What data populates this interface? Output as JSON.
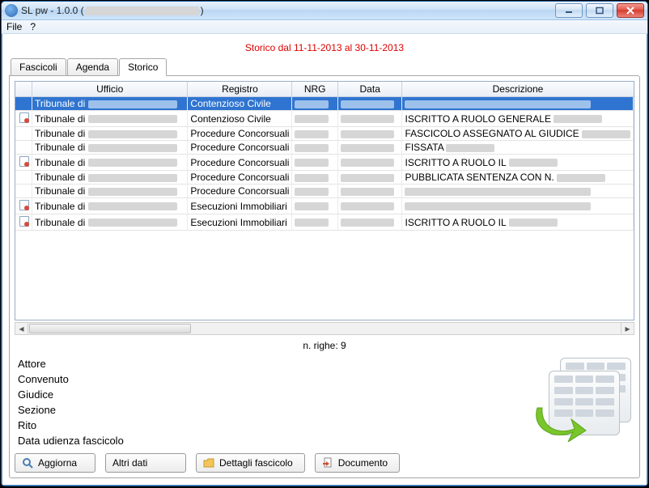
{
  "window": {
    "title_prefix": "SL pw - 1.0.0 (",
    "title_suffix": ")"
  },
  "menu": {
    "file": "File",
    "help": "?"
  },
  "banner": "Storico dal 11-11-2013 al 30-11-2013",
  "tabs": {
    "fascicoli": "Fascicoli",
    "agenda": "Agenda",
    "storico": "Storico"
  },
  "columns": {
    "ufficio": "Ufficio",
    "registro": "Registro",
    "nrg": "NRG",
    "data": "Data",
    "descrizione": "Descrizione"
  },
  "rows": [
    {
      "icon": false,
      "ufficio": "Tribunale di",
      "registro": "Contenzioso Civile",
      "desc": "",
      "selected": true
    },
    {
      "icon": true,
      "ufficio": "Tribunale di",
      "registro": "Contenzioso Civile",
      "desc": "ISCRITTO A RUOLO GENERALE"
    },
    {
      "icon": false,
      "ufficio": "Tribunale di",
      "registro": "Procedure Concorsuali",
      "desc": "FASCICOLO ASSEGNATO AL GIUDICE"
    },
    {
      "icon": false,
      "ufficio": "Tribunale di",
      "registro": "Procedure Concorsuali",
      "desc": "FISSATA"
    },
    {
      "icon": true,
      "ufficio": "Tribunale di",
      "registro": "Procedure Concorsuali",
      "desc": "ISCRITTO A RUOLO IL"
    },
    {
      "icon": false,
      "ufficio": "Tribunale di",
      "registro": "Procedure Concorsuali",
      "desc": "PUBBLICATA SENTENZA CON N."
    },
    {
      "icon": false,
      "ufficio": "Tribunale di",
      "registro": "Procedure Concorsuali",
      "desc": ""
    },
    {
      "icon": true,
      "ufficio": "Tribunale di",
      "registro": "Esecuzioni Immobiliari",
      "desc": ""
    },
    {
      "icon": true,
      "ufficio": "Tribunale di",
      "registro": "Esecuzioni Immobiliari",
      "desc": "ISCRITTO A RUOLO IL"
    }
  ],
  "row_count_label": "n. righe: 9",
  "details": {
    "attore": "Attore",
    "convenuto": "Convenuto",
    "giudice": "Giudice",
    "sezione": "Sezione",
    "rito": "Rito",
    "data_ud": "Data udienza fascicolo"
  },
  "buttons": {
    "aggiorna": "Aggiorna",
    "altri_dati": "Altri dati",
    "dettagli": "Dettagli fascicolo",
    "documento": "Documento"
  }
}
